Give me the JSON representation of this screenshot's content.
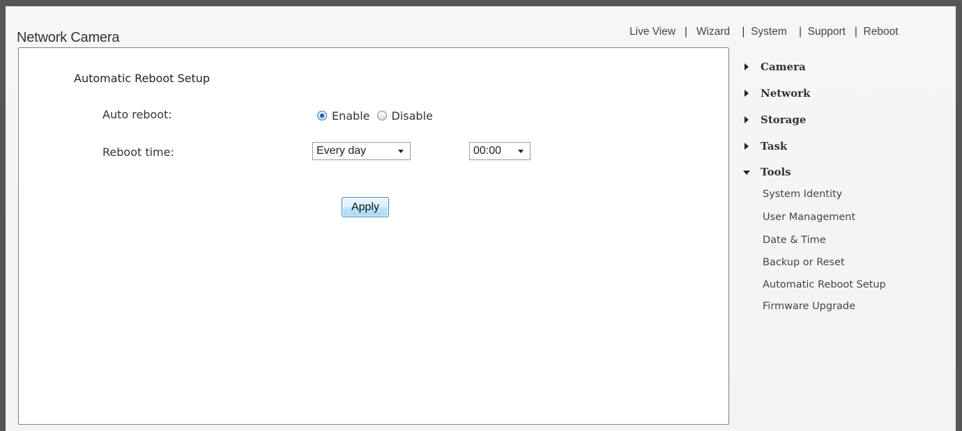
{
  "header": {
    "brand": "Network Camera",
    "nav": [
      "Live View",
      "Wizard",
      "System",
      "Support",
      "Reboot"
    ]
  },
  "main": {
    "section_title": "Automatic Reboot Setup",
    "auto_reboot": {
      "label": "Auto reboot:",
      "options": [
        "Enable",
        "Disable"
      ],
      "selected": "Enable"
    },
    "reboot_time": {
      "label": "Reboot time:",
      "frequency": "Every day",
      "time": "00:00"
    },
    "apply_label": "Apply"
  },
  "sidebar": {
    "sections": [
      {
        "label": "Camera",
        "expanded": false
      },
      {
        "label": "Network",
        "expanded": false
      },
      {
        "label": "Storage",
        "expanded": false
      },
      {
        "label": "Task",
        "expanded": false
      },
      {
        "label": "Tools",
        "expanded": true
      }
    ],
    "tools_items": [
      "System Identity",
      "User Management",
      "Date & Time",
      "Backup or Reset",
      "Automatic Reboot Setup",
      "Firmware Upgrade"
    ]
  }
}
